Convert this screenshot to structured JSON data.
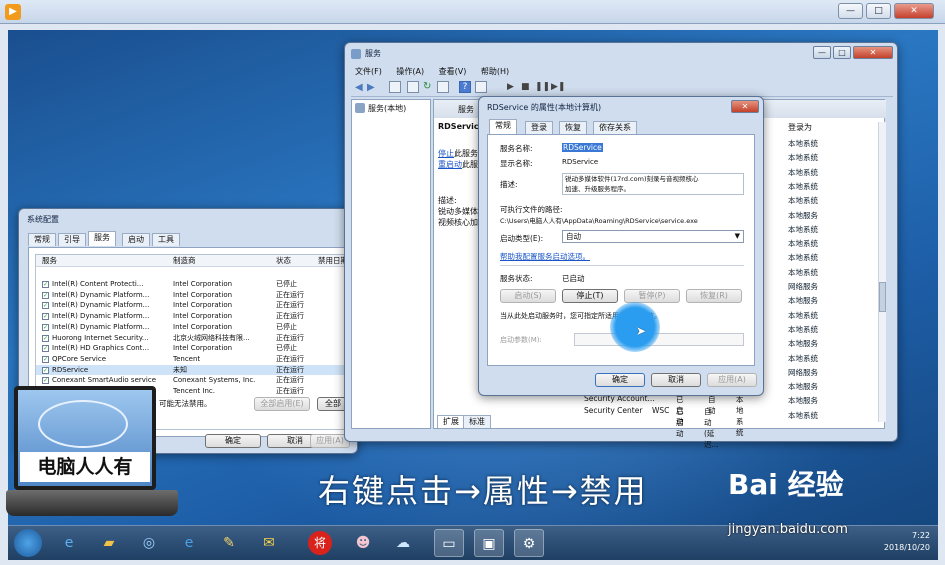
{
  "player": {
    "minimize": "—",
    "maximize": "□",
    "close": "✕"
  },
  "services_window": {
    "title": "服务",
    "menu": [
      "文件(F)",
      "操作(A)",
      "查看(V)",
      "帮助(H)"
    ],
    "tree_item": "服务(本地)",
    "header_partial": "服务",
    "selected_name": "RDService",
    "stop_link": "停止",
    "stop_suffix": "此服务",
    "restart_link": "重启动",
    "restart_suffix": "此服",
    "desc_label": "描述:",
    "desc_text_1": "锐动多媒体",
    "desc_text_2": "视频核心加",
    "logon_header": "登录为",
    "logon_values": [
      "本地系统",
      "本地系统",
      "本地系统",
      "本地系统",
      "本地系统",
      "本地服务",
      "本地系统",
      "本地系统",
      "本地系统",
      "本地系统",
      "网络服务",
      "本地服务",
      "本地系统",
      "本地系统",
      "本地服务",
      "本地系统",
      "网络服务",
      "本地服务",
      "本地服务",
      "本地系统"
    ],
    "bottom_rows": [
      {
        "name": "Security Account...",
        "status": "已启动",
        "type": "自动",
        "logon": "本地系统"
      },
      {
        "name": "Security Center",
        "status": "WSC",
        "type": "已启动",
        "logon": "自动(延迟..."
      }
    ],
    "tabs": [
      "扩展",
      "标准"
    ]
  },
  "properties_dialog": {
    "title": "RDService 的属性(本地计算机)",
    "close": "✕",
    "tabs": [
      "常规",
      "登录",
      "恢复",
      "依存关系"
    ],
    "service_name_label": "服务名称:",
    "service_name_value": "RDService",
    "display_name_label": "显示名称:",
    "display_name_value": "RDService",
    "description_label": "描述:",
    "description_value_1": "锐动多媒体软件(17rd.com)刻录与音视频核心",
    "description_value_2": "加速、升级服务程序。",
    "exe_path_label": "可执行文件的路径:",
    "exe_path_value": "C:\\Users\\电脑人人有\\AppData\\Roaming\\RDService\\service.exe",
    "startup_type_label": "启动类型(E):",
    "startup_type_value": "自动",
    "help_link": "帮助我配置服务启动选项。",
    "status_label": "服务状态:",
    "status_value": "已启动",
    "btn_start": "启动(S)",
    "btn_stop": "停止(T)",
    "btn_pause": "暂停(P)",
    "btn_resume": "恢复(R)",
    "hint": "当从此处启动服务时，您可指定所适用的启动参数。",
    "params_label": "启动参数(M):",
    "btn_ok": "确定",
    "btn_cancel": "取消",
    "btn_apply": "应用(A)"
  },
  "msconfig": {
    "title": "系统配置",
    "tabs": [
      "常规",
      "引导",
      "服务",
      "启动",
      "工具"
    ],
    "col_service": "服务",
    "col_maker": "制造商",
    "col_status": "状态",
    "col_disabled": "禁用日期",
    "rows": [
      {
        "name": "Intel(R) Content Protecti...",
        "maker": "Intel Corporation",
        "status": "已停止"
      },
      {
        "name": "Intel(R) Dynamic Platform...",
        "maker": "Intel Corporation",
        "status": "正在运行"
      },
      {
        "name": "Intel(R) Dynamic Platform...",
        "maker": "Intel Corporation",
        "status": "正在运行"
      },
      {
        "name": "Intel(R) Dynamic Platform...",
        "maker": "Intel Corporation",
        "status": "正在运行"
      },
      {
        "name": "Intel(R) Dynamic Platform...",
        "maker": "Intel Corporation",
        "status": "已停止"
      },
      {
        "name": "Huorong Internet Security...",
        "maker": "北京火绒网络科技有限...",
        "status": "正在运行"
      },
      {
        "name": "Intel(R) HD Graphics Cont...",
        "maker": "Intel Corporation",
        "status": "已停止"
      },
      {
        "name": "QPCore Service",
        "maker": "Tencent",
        "status": "正在运行"
      },
      {
        "name": "RDService",
        "maker": "未知",
        "status": "正在运行"
      },
      {
        "name": "Conexant SmartAudio service",
        "maker": "Conexant Systems, Inc.",
        "status": "正在运行"
      },
      {
        "name": "TsQBService",
        "maker": "Tencent Inc.",
        "status": "正在运行"
      }
    ],
    "note": "可能无法禁用。",
    "btn_enable_all": "全部启用(E)",
    "btn_disable_all": "全部",
    "btn_ok": "确定",
    "btn_cancel": "取消",
    "btn_apply": "应用(A)"
  },
  "laptop_label": "电脑人人有",
  "caption": "右键点击→属性→禁用",
  "baidu": {
    "logo": "Bai 经验",
    "url": "jingyan.baidu.com"
  },
  "clock": {
    "time": "7:22",
    "date": "2018/10/20"
  },
  "taskbar_icons": [
    "start-orb",
    "ie",
    "explorer",
    "app-circle",
    "ie-2",
    "paint",
    "chat",
    "jiang",
    "face",
    "cloud",
    "screen",
    "monitor",
    "gear"
  ]
}
